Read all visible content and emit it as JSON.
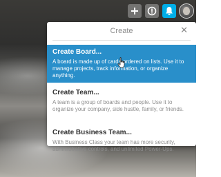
{
  "header": {
    "add_icon": "plus-icon",
    "info_icon": "info-icon",
    "notification_icon": "bell-icon",
    "accent_color": "#00aee8"
  },
  "popover": {
    "title": "Create",
    "close_icon": "close-icon",
    "items": [
      {
        "title": "Create Board...",
        "description": "A board is made up of cards ordered on lists. Use it to manage projects, track information, or organize anything.",
        "highlighted": true
      },
      {
        "title": "Create Team...",
        "description": "A team is a group of boards and people. Use it to organize your company, side hustle, family, or friends.",
        "highlighted": false
      },
      {
        "title": "Create Business Team...",
        "description": "With Business Class your team has more security, administrative controls, and unlimited Power-Ups.",
        "highlighted": false
      }
    ],
    "highlight_color": "#298fca"
  }
}
